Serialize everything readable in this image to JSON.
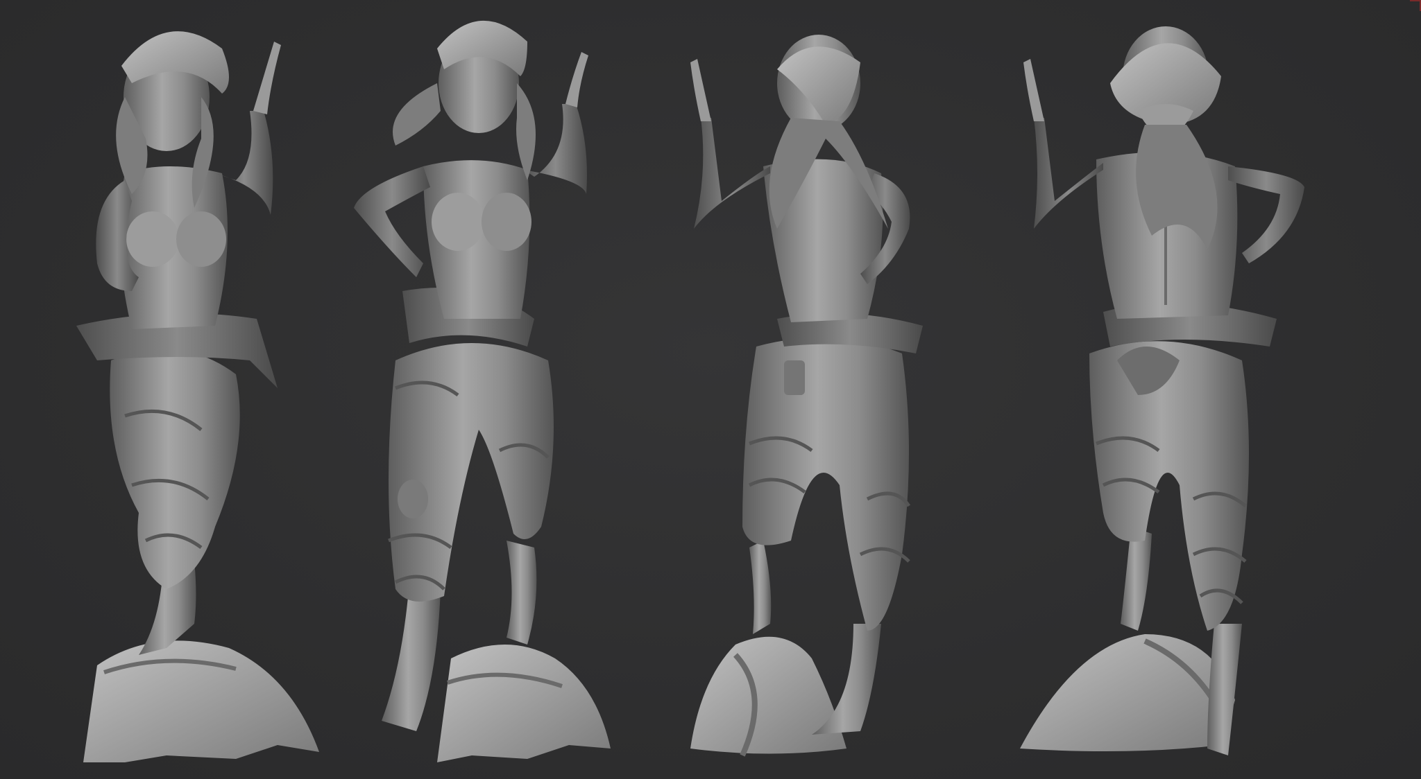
{
  "scene": {
    "background_color": "#2e2e2f",
    "model_color": "#8a8a8a",
    "model_shadow_color": "#5c5c5c",
    "model_highlight_color": "#b3b3b3"
  },
  "views": [
    {
      "id": "front-left"
    },
    {
      "id": "front"
    },
    {
      "id": "back-left"
    },
    {
      "id": "back"
    }
  ]
}
